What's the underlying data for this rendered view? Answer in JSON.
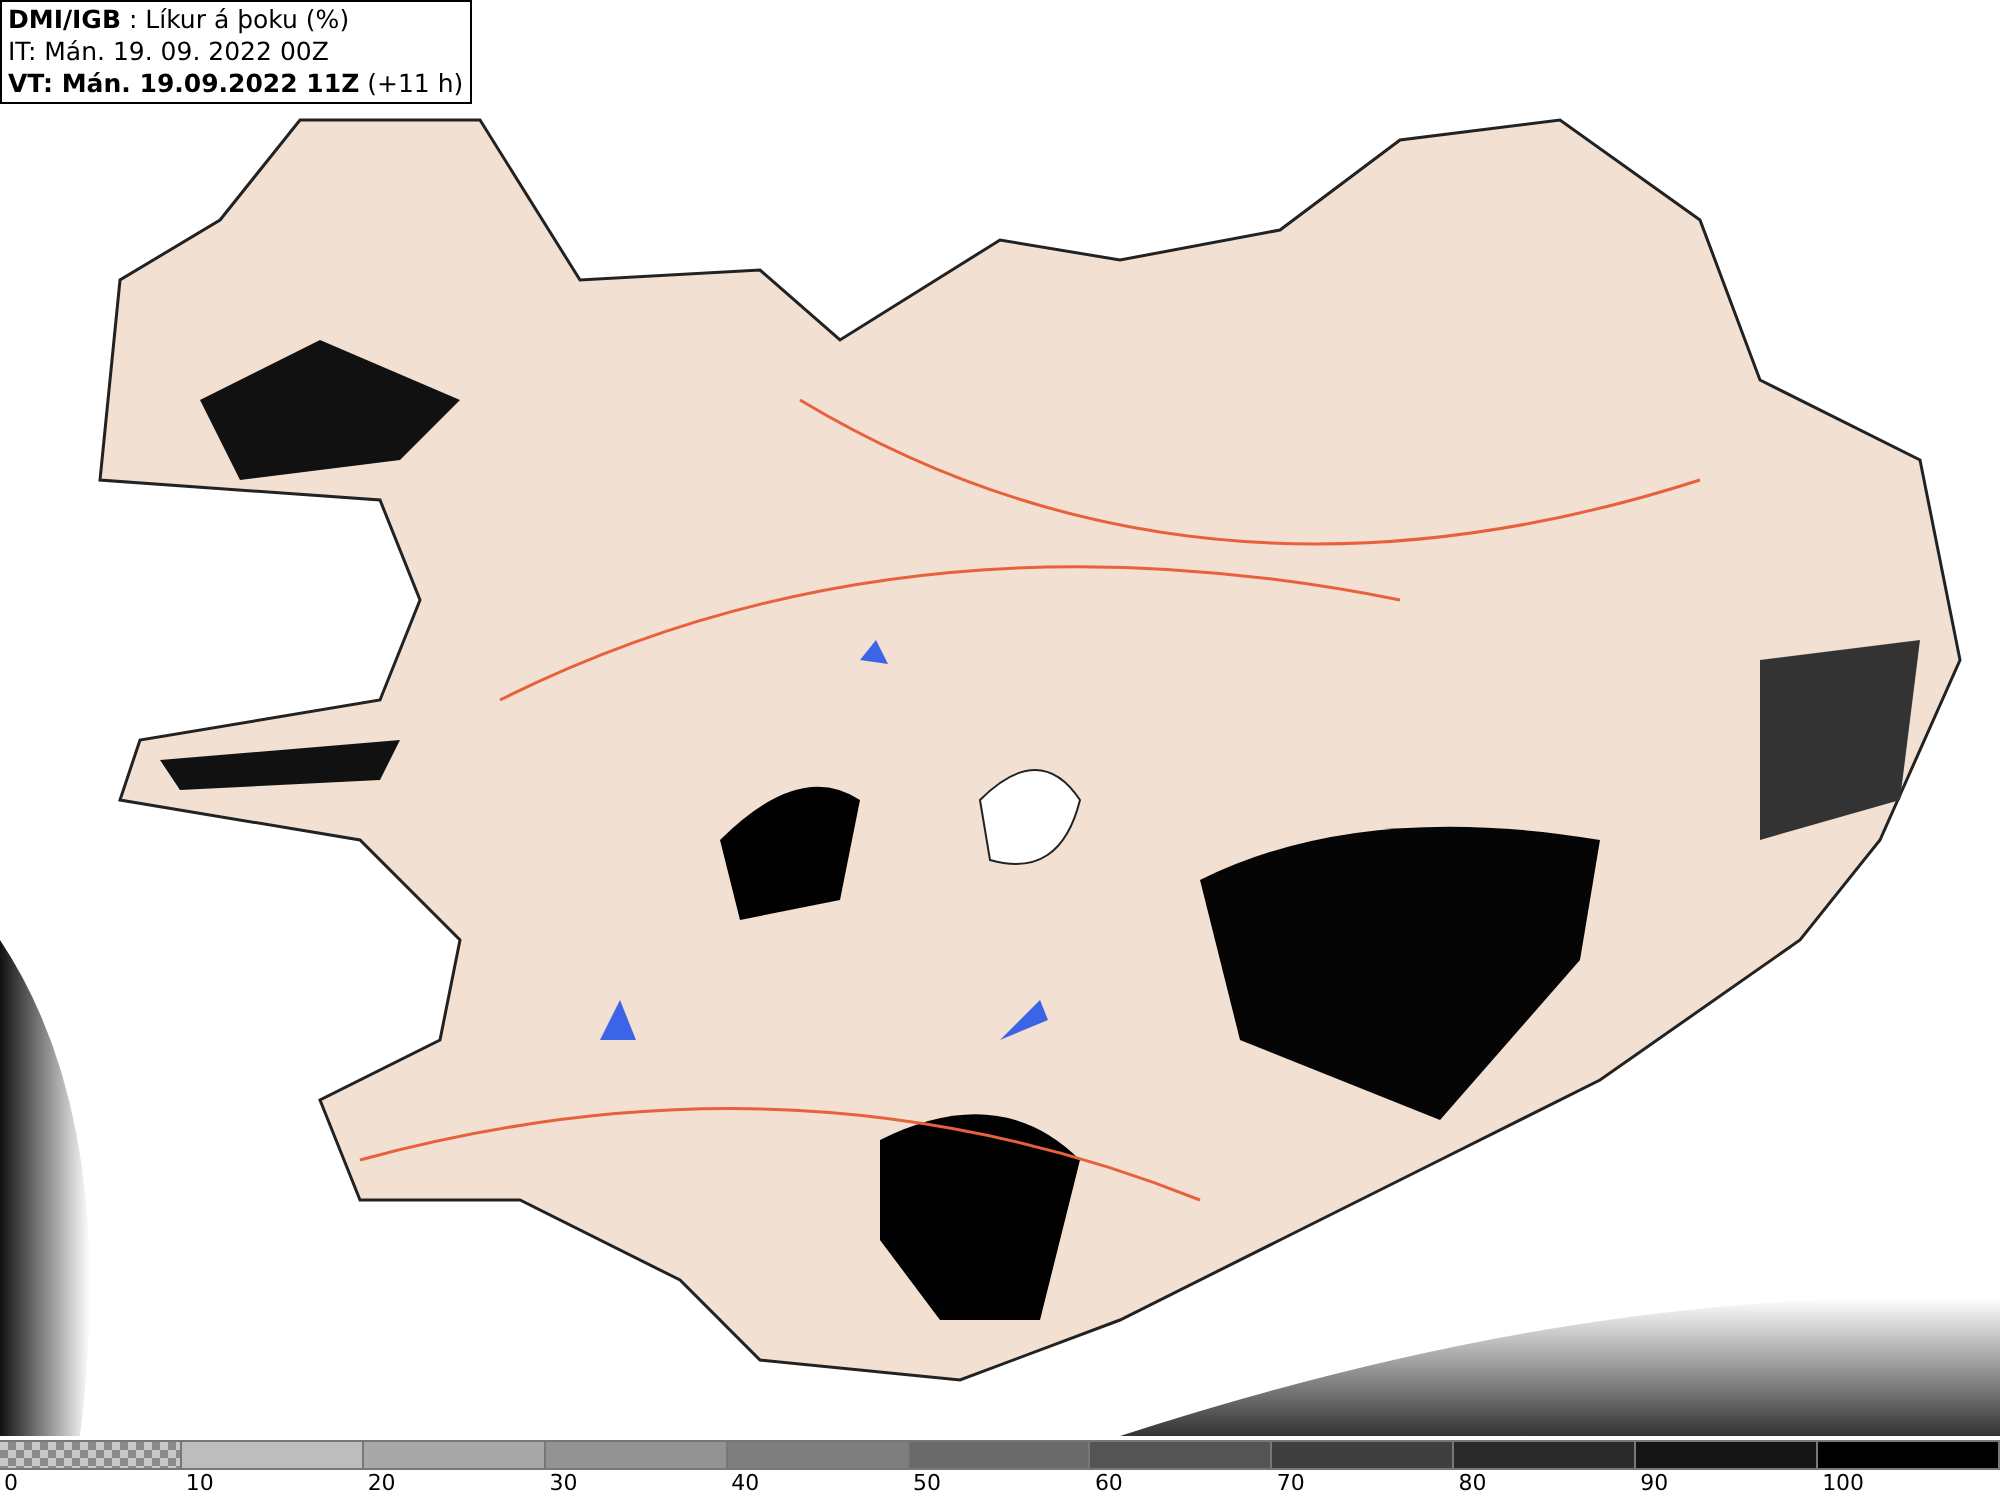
{
  "info_box": {
    "lines": [
      "**DMI/IGB** : Líkur á þoku (%)",
      "IT: Mán. 19. 09. 2022 00Z",
      "**VT: Mán. 19.09.2022 11Z** (+11 h)"
    ]
  },
  "legend": {
    "bins": [
      {
        "kind": "pattern",
        "color": "#8a8a8a"
      },
      {
        "kind": "solid",
        "color": "#bdbdbd"
      },
      {
        "kind": "solid",
        "color": "#a8a8a8"
      },
      {
        "kind": "solid",
        "color": "#939393"
      },
      {
        "kind": "solid",
        "color": "#7e7e7e"
      },
      {
        "kind": "solid",
        "color": "#696969"
      },
      {
        "kind": "solid",
        "color": "#545454"
      },
      {
        "kind": "solid",
        "color": "#3f3f3f"
      },
      {
        "kind": "solid",
        "color": "#2a2a2a"
      },
      {
        "kind": "solid",
        "color": "#151515"
      },
      {
        "kind": "solid",
        "color": "#000000"
      }
    ],
    "ticks": [
      "0",
      "10",
      "20",
      "30",
      "40",
      "50",
      "60",
      "70",
      "80",
      "90",
      "100"
    ]
  }
}
